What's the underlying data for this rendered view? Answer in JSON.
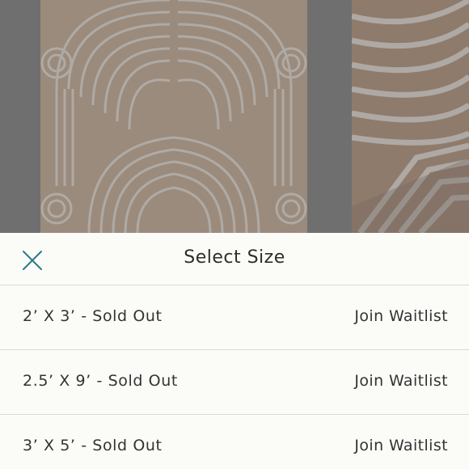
{
  "sheet": {
    "title": "Select Size",
    "close_icon": "close-x-icon",
    "accent_color": "#2a7a8c"
  },
  "sizes": [
    {
      "label": "2’ X 3’ - Sold Out",
      "action": "Join Waitlist"
    },
    {
      "label": "2.5’ X 9’ - Sold Out",
      "action": "Join Waitlist"
    },
    {
      "label": "3’ X 5’ - Sold Out",
      "action": "Join Waitlist"
    }
  ]
}
